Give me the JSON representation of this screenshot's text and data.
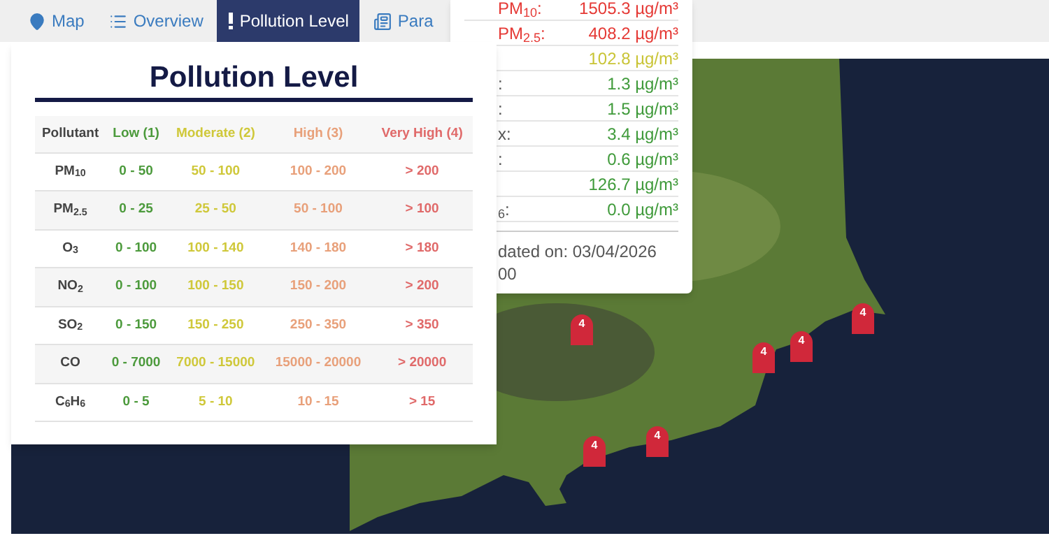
{
  "tabs": [
    {
      "label": "Map",
      "selected": false
    },
    {
      "label": "Overview",
      "selected": false
    },
    {
      "label": "Pollution Level",
      "selected": true
    },
    {
      "label": "Para",
      "selected": false
    }
  ],
  "popup": {
    "rows": [
      {
        "label": "PM$_{10}$:",
        "value": "1505.3 µg/m³",
        "color": "#e53935"
      },
      {
        "label": "PM$_{2.5}$:",
        "value": "408.2 µg/m³",
        "color": "#e53935"
      },
      {
        "value": "102.8 µg/m³",
        "color": "#c9c436"
      },
      {
        "label": ":",
        "value": "1.3 µg/m³",
        "color": "#3f9a3a"
      },
      {
        "label": ":",
        "value": "1.5 µg/m³",
        "color": "#3f9a3a"
      },
      {
        "label": "x:",
        "value": "3.4 µg/m³",
        "color": "#3f9a3a"
      },
      {
        "label": ":",
        "value": "0.6 µg/m³",
        "color": "#3f9a3a"
      },
      {
        "value": "126.7 µg/m³",
        "color": "#3f9a3a"
      },
      {
        "label": "$_{6}$:",
        "value": "0.0 µg/m³",
        "color": "#3f9a3a"
      }
    ],
    "footer": [
      "dated on: 03/04/2026",
      "00"
    ]
  },
  "panel": {
    "title": "Pollution Level",
    "columns": [
      "Pollutant",
      "Low (1)",
      "Moderate (2)",
      "High (3)",
      "Very High (4)"
    ],
    "rows": [
      [
        "PM$_{10}$",
        "0 - 50",
        "50 - 100",
        "100 - 200",
        "> 200"
      ],
      [
        "PM$_{2.5}$",
        "0 - 25",
        "25 - 50",
        "50 - 100",
        "> 100"
      ],
      [
        "O$_{3}$",
        "0 - 100",
        "100 - 140",
        "140 - 180",
        "> 180"
      ],
      [
        "NO$_{2}$",
        "0 - 100",
        "100 - 150",
        "150 - 200",
        "> 200"
      ],
      [
        "SO$_{2}$",
        "0 - 150",
        "150 - 250",
        "250 - 350",
        "> 350"
      ],
      [
        "CO",
        "0 - 7000",
        "7000 - 15000",
        "15000 - 20000",
        "> 20000"
      ],
      [
        "C$_{6}$H$_{6}$",
        "0 - 5",
        "5 - 10",
        "10 - 15",
        "> 15"
      ]
    ]
  },
  "map": {
    "markers": [
      "4",
      "4",
      "4",
      "4",
      "4",
      "4"
    ]
  }
}
